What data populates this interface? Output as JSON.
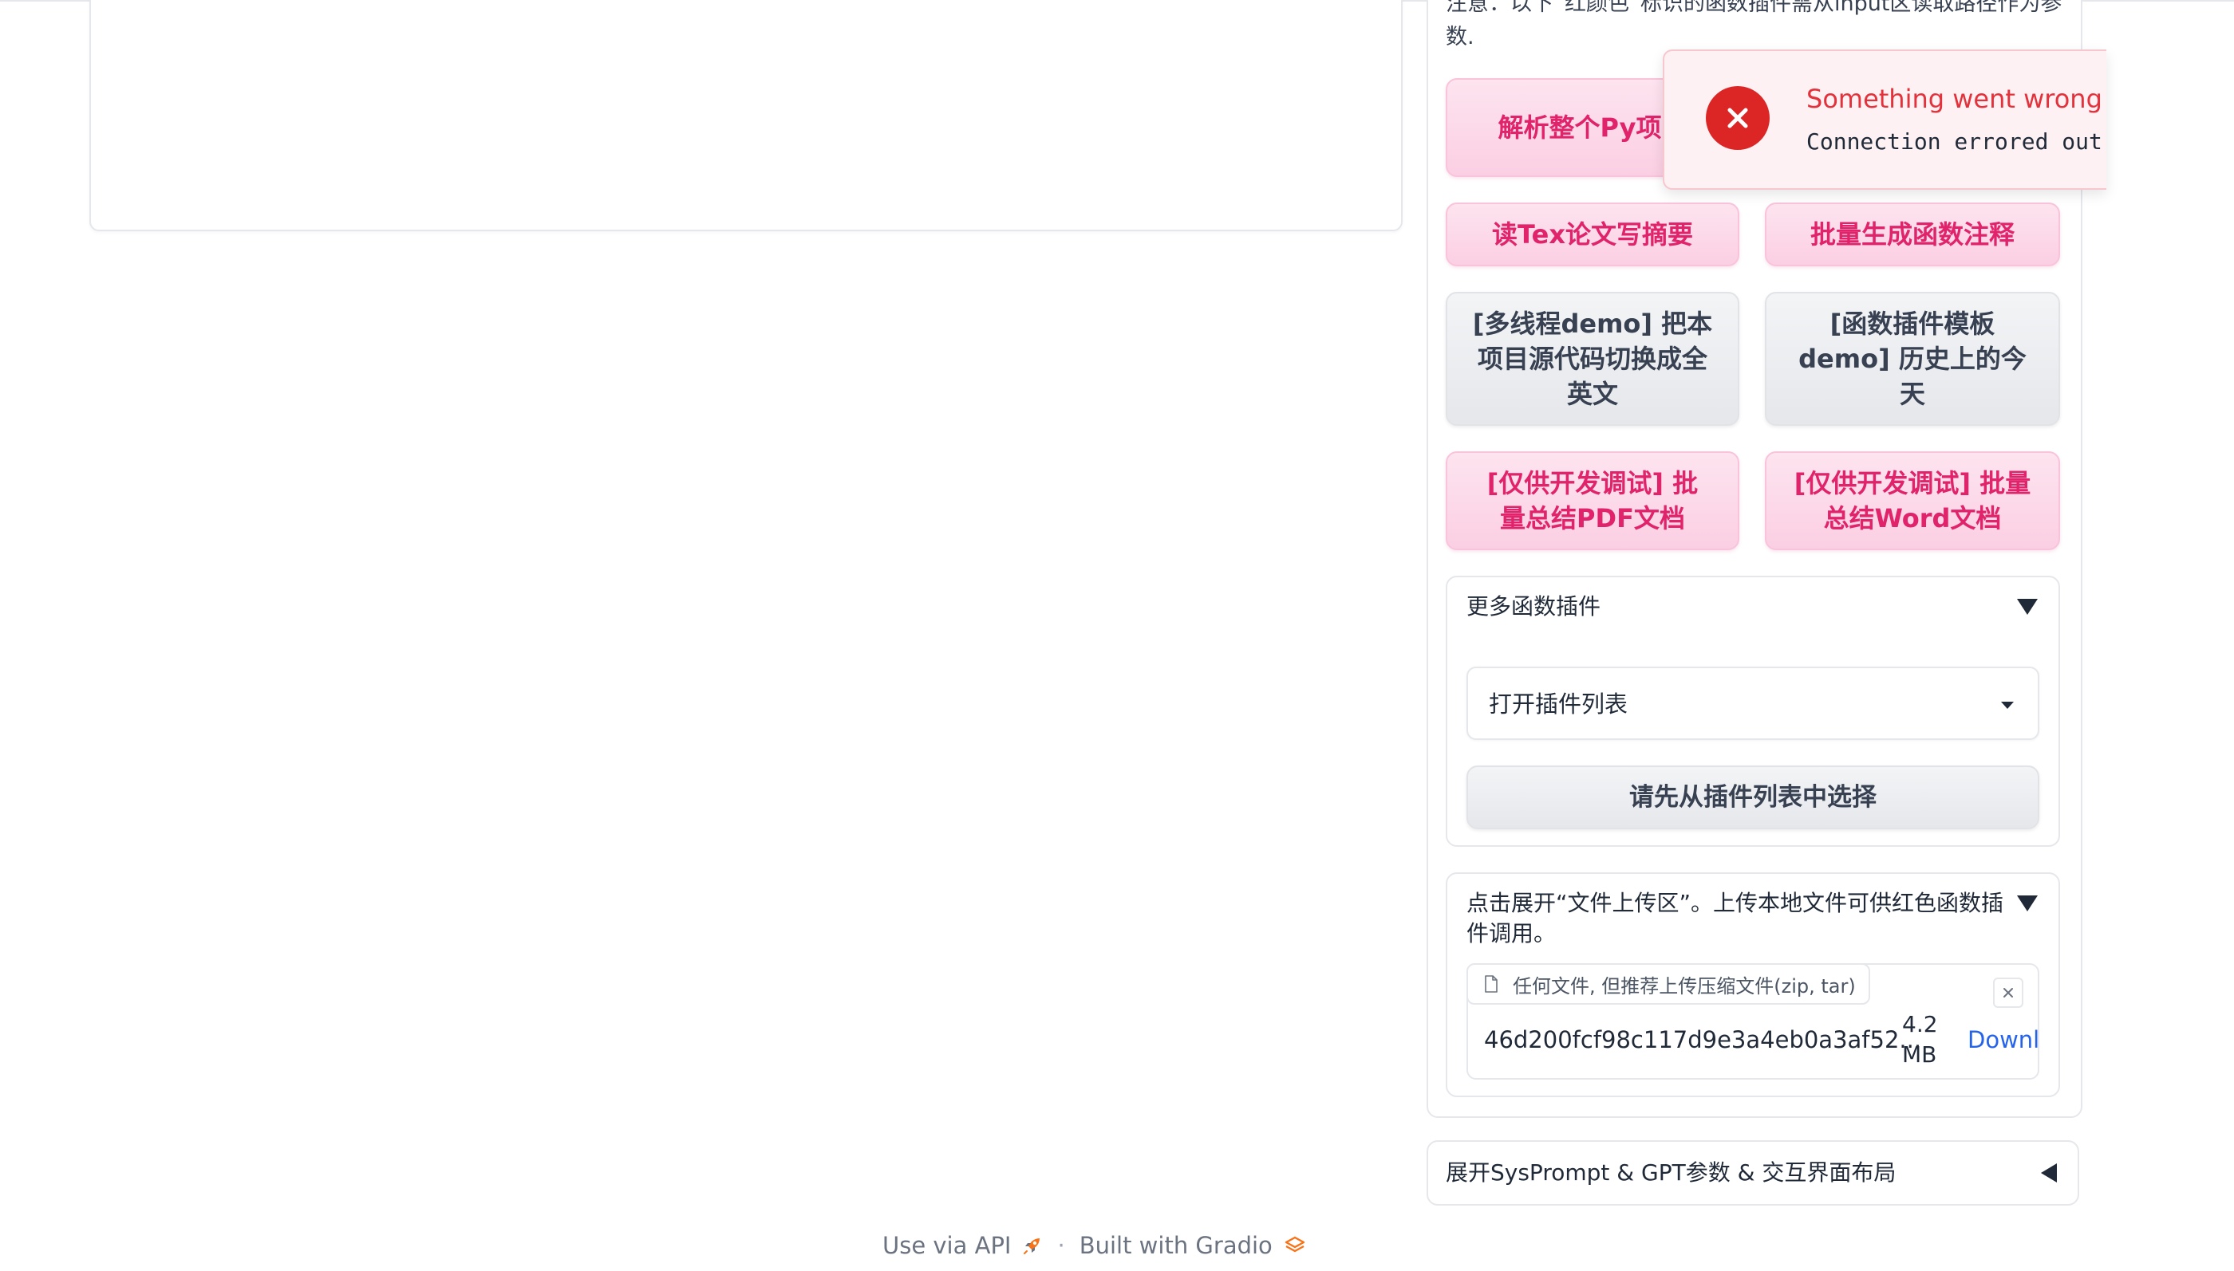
{
  "note": {
    "text": "注意：以下“红颜色”标识的函数插件需从input区读取路径作为参数."
  },
  "plugins": {
    "parse_py": "解析整个Py项目",
    "tex_abstract": "读Tex论文写摘要",
    "batch_comments": "批量生成函数注释",
    "multithread_demo": "[多线程demo] 把本项目源代码切换成全英文",
    "template_demo": "[函数插件模板demo] 历史上的今天",
    "pdf_summary": "[仅供开发调试] 批量总结PDF文档",
    "word_summary": "[仅供开发调试] 批量总结Word文档"
  },
  "more_plugins": {
    "title": "更多函数插件",
    "dropdown_value": "打开插件列表",
    "select_button": "请先从插件列表中选择"
  },
  "upload": {
    "title": "点击展开“文件上传区”。上传本地文件可供红色函数插件调用。",
    "label": "任何文件, 但推荐上传压缩文件(zip, tar)",
    "file_name": "46d200fcf98c117d9e3a4eb0a3af52...",
    "file_size": "4.2 MB",
    "download": "Download"
  },
  "sysprompt": {
    "title": "展开SysPrompt & GPT参数 & 交互界面布局"
  },
  "toast": {
    "title": "Something went wrong",
    "message": "Connection errored out."
  },
  "footer": {
    "api": "Use via API",
    "separator": "·",
    "built": "Built with Gradio"
  },
  "colors": {
    "accent_pink": "#e0236b",
    "error_red": "#dc2626",
    "link_blue": "#2563eb"
  },
  "icons": [
    "rocket-icon",
    "gradio-logo-icon",
    "file-icon",
    "close-icon",
    "error-icon",
    "chevron-down-icon",
    "chevron-left-icon"
  ]
}
